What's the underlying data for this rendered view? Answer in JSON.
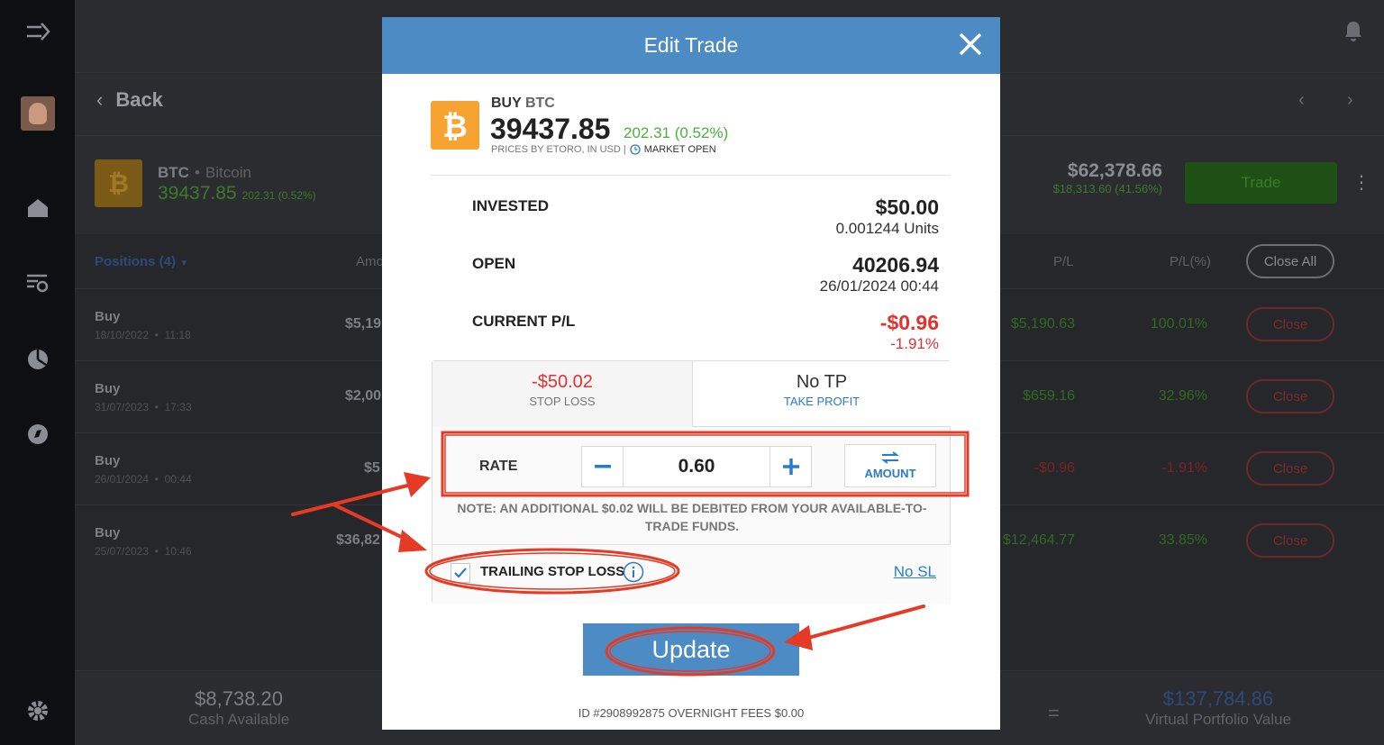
{
  "background": {
    "back_label": "Back",
    "asset": {
      "symbol": "BTC",
      "name": "Bitcoin",
      "price": "39437.85",
      "change": "202.31 (0.52%)"
    },
    "equity": {
      "value": "$62,378.66",
      "change": "$18,313.60 (41.56%)"
    },
    "trade_label": "Trade",
    "positions_label": "Positions (4)",
    "columns": {
      "amount": "Amo",
      "pl": "P/L",
      "plp": "P/L(%)"
    },
    "close_all_label": "Close All",
    "positions": [
      {
        "side": "Buy",
        "date": "18/10/2022",
        "time": "11:18",
        "amount": "$5,19",
        "pl": "$5,190.63",
        "plp": "100.01%",
        "close": "Close"
      },
      {
        "side": "Buy",
        "date": "31/07/2023",
        "time": "17:33",
        "amount": "$2,00",
        "pl": "$659.16",
        "plp": "32.96%",
        "close": "Close"
      },
      {
        "side": "Buy",
        "date": "26/01/2024",
        "time": "00:44",
        "amount": "$5",
        "pl": "-$0.96",
        "plp": "-1.91%",
        "close": "Close"
      },
      {
        "side": "Buy",
        "date": "25/07/2023",
        "time": "10:46",
        "amount": "$36,82",
        "pl": "$12,464.77",
        "plp": "33.85%",
        "close": "Close"
      }
    ],
    "footer": {
      "cash_value": "$8,738.20",
      "cash_label": "Cash Available",
      "equals": "=",
      "vpv_value": "$137,784.86",
      "vpv_label": "Virtual Portfolio Value"
    }
  },
  "modal": {
    "title": "Edit Trade",
    "buy_label": "BUY",
    "symbol": "BTC",
    "price": "39437.85",
    "price_change": "202.31 (0.52%)",
    "prices_by": "PRICES BY ETORO, IN USD |",
    "market_status": "MARKET OPEN",
    "invested_label": "INVESTED",
    "invested_value": "$50.00",
    "units": "0.001244 Units",
    "open_label": "OPEN",
    "open_value": "40206.94",
    "open_date": "26/01/2024 00:44",
    "pl_label": "CURRENT P/L",
    "pl_value": "-$0.96",
    "pl_percent": "-1.91%",
    "stop_loss_value": "-$50.02",
    "stop_loss_label": "STOP LOSS",
    "take_profit_value": "No TP",
    "take_profit_label": "TAKE PROFIT",
    "rate_label": "RATE",
    "rate_value": "0.60",
    "amount_label": "AMOUNT",
    "note": "NOTE: AN ADDITIONAL $0.02 WILL BE DEBITED FROM YOUR AVAILABLE-TO-TRADE FUNDS.",
    "tsl_label": "TRAILING STOP LOSS",
    "tsl_checked": true,
    "no_sl_label": "No SL",
    "update_label": "Update",
    "footer_id": "ID #2908992875 OVERNIGHT FEES $0.00"
  },
  "colors": {
    "accent_blue": "#4c8bc4",
    "loss_red": "#e2312e",
    "gain_green": "#4caf3c",
    "annotation_red": "#e53a26",
    "btc_orange": "#f7a331"
  }
}
